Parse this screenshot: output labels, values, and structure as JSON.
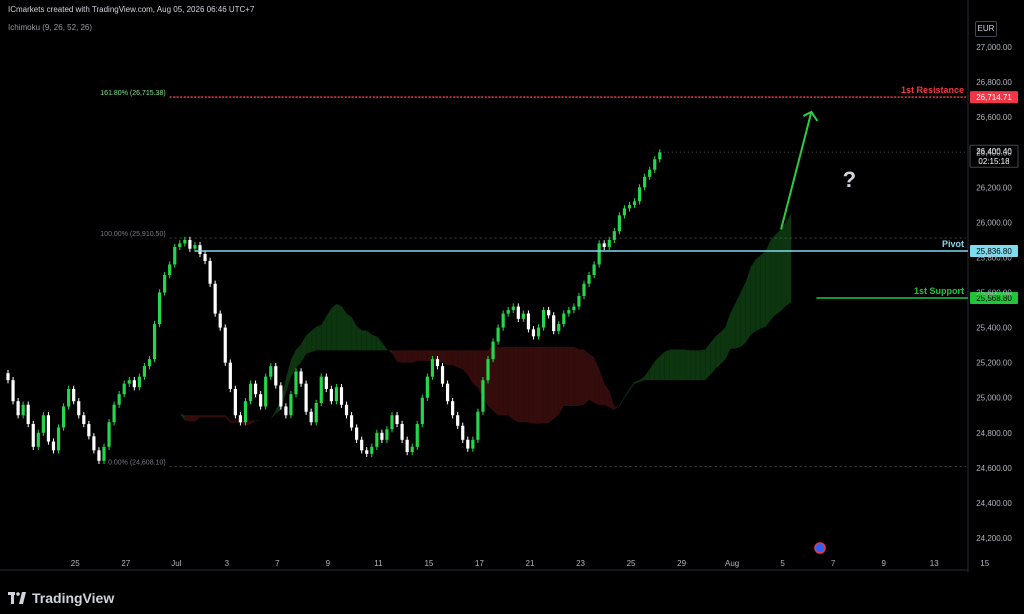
{
  "header": {
    "title": "ICmarkets created with TradingView.com, Aug 05, 2026 06:46 UTC+7",
    "indicator": "Ichimoku (9, 26, 52, 26)",
    "currency": "EUR"
  },
  "footer": {
    "brand": "TradingView"
  },
  "colors": {
    "up": "#26d64a",
    "down": "#ffffff",
    "resistance": "#f23645",
    "pivot": "#7fdbee",
    "support": "#22c43a",
    "cloud_bull": "#0e3b12",
    "cloud_bear": "#3b0d0d",
    "fib": "#787b86",
    "arrow": "#2ecc40"
  },
  "chart_data": {
    "type": "candlestick",
    "title": "",
    "xlabel": "",
    "ylabel": "",
    "ylim": [
      24120,
      27200
    ],
    "y_ticks": [
      24200,
      24400,
      24600,
      24800,
      25000,
      25200,
      25400,
      25600,
      25800,
      26000,
      26200,
      26400,
      26600,
      26800,
      27000
    ],
    "y_tick_labels": [
      "24,200.00",
      "24,400.00",
      "24,600.00",
      "24,800.00",
      "25,000.00",
      "25,200.00",
      "25,400.00",
      "25,600.00",
      "25,800.00",
      "26,000.00",
      "26,200.00",
      "26,400.00",
      "26,600.00",
      "26,800.00",
      "27,000.00"
    ],
    "x_ticks": [
      {
        "i": 5,
        "label": "25"
      },
      {
        "i": 15,
        "label": "27"
      },
      {
        "i": 25,
        "label": "Jul"
      },
      {
        "i": 35,
        "label": "3"
      },
      {
        "i": 45,
        "label": "7"
      },
      {
        "i": 55,
        "label": "9"
      },
      {
        "i": 65,
        "label": "11"
      },
      {
        "i": 75,
        "label": "15"
      },
      {
        "i": 85,
        "label": "17"
      },
      {
        "i": 95,
        "label": "21"
      },
      {
        "i": 105,
        "label": "23"
      },
      {
        "i": 115,
        "label": "25"
      },
      {
        "i": 125,
        "label": "29"
      },
      {
        "i": 135,
        "label": "Aug"
      },
      {
        "i": 145,
        "label": "5"
      },
      {
        "i": 155,
        "label": "7"
      },
      {
        "i": 165,
        "label": "9"
      },
      {
        "i": 175,
        "label": "13"
      },
      {
        "i": 185,
        "label": "15"
      }
    ],
    "candle_closes": [
      25100,
      24980,
      24900,
      24960,
      24850,
      24720,
      24800,
      24900,
      24750,
      24700,
      24830,
      24950,
      25050,
      24980,
      24900,
      24850,
      24780,
      24700,
      24640,
      24720,
      24860,
      24960,
      25020,
      25080,
      25100,
      25060,
      25120,
      25180,
      25220,
      25420,
      25600,
      25700,
      25760,
      25860,
      25880,
      25900,
      25850,
      25870,
      25820,
      25780,
      25650,
      25480,
      25400,
      25200,
      25050,
      24900,
      24860,
      24980,
      25080,
      25020,
      24950,
      25120,
      25180,
      25070,
      24950,
      24900,
      25020,
      25150,
      25080,
      24920,
      24860,
      24970,
      25120,
      25050,
      24980,
      25060,
      24960,
      24900,
      24830,
      24760,
      24700,
      24680,
      24720,
      24800,
      24760,
      24820,
      24900,
      24850,
      24760,
      24690,
      24720,
      24850,
      25000,
      25120,
      25220,
      25180,
      25080,
      24980,
      24900,
      24840,
      24760,
      24710,
      24760,
      24920,
      25100,
      25220,
      25320,
      25400,
      25480,
      25500,
      25520,
      25450,
      25480,
      25390,
      25350,
      25400,
      25500,
      25470,
      25380,
      25420,
      25480,
      25500,
      25520,
      25580,
      25650,
      25700,
      25760,
      25880,
      25860,
      25900,
      25950,
      26040,
      26080,
      26100,
      26120,
      26200,
      26260,
      26300,
      26360,
      26400
    ],
    "price_levels": [
      {
        "name": "1st Resistance",
        "value": 26714.71,
        "label": "26,714.71",
        "color": "#f23645"
      },
      {
        "name": "Pivot",
        "value": 25836.8,
        "label": "25,836.80",
        "color": "#7fdbee"
      },
      {
        "name": "1st Support",
        "value": 25568.8,
        "label": "25,568.80",
        "color": "#22c43a"
      }
    ],
    "fib_levels": [
      {
        "label": "161.80% (26,715.38)",
        "value": 26715.38
      },
      {
        "label": "100.00% (25,910.50)",
        "value": 25910.5
      },
      {
        "label": "0.00% (24,608.10)",
        "value": 24608.1
      }
    ],
    "current_price": {
      "label": "26,400.40",
      "countdown": "02:15:18",
      "value": 26400.4
    },
    "annotation": "?",
    "forecast_arrow": {
      "from_index": 153,
      "from_value": 25960,
      "to_index": 159,
      "to_value": 26630
    }
  }
}
